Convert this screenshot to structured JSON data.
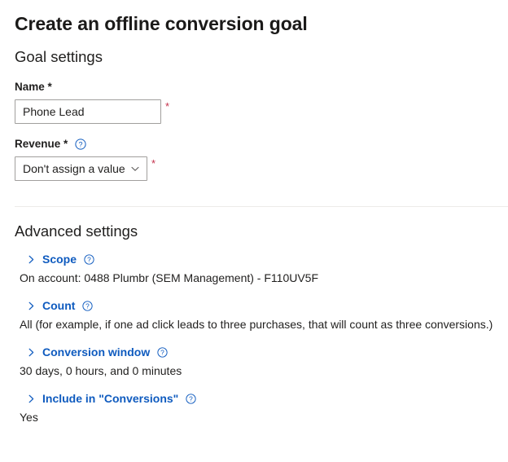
{
  "page": {
    "title": "Create an offline conversion goal"
  },
  "goal_settings": {
    "heading": "Goal settings",
    "name_field": {
      "label": "Name *",
      "value": "Phone Lead",
      "placeholder": "",
      "required_marker": "*"
    },
    "revenue_field": {
      "label": "Revenue *",
      "help_icon": "help-circle-icon",
      "selected_option": "Don't assign a value",
      "required_marker": "*",
      "chevron_icon": "chevron-down-icon"
    }
  },
  "advanced_settings": {
    "heading": "Advanced settings",
    "groups": [
      {
        "title": "Scope",
        "value": "On account: 0488 Plumbr (SEM Management) - F110UV5F",
        "expand_icon": "chevron-right-icon",
        "help_icon": "help-circle-icon"
      },
      {
        "title": "Count",
        "value": "All (for example, if one ad click leads to three purchases, that will count as three conversions.)",
        "expand_icon": "chevron-right-icon",
        "help_icon": "help-circle-icon"
      },
      {
        "title": "Conversion window",
        "value": "30 days, 0 hours, and 0 minutes",
        "expand_icon": "chevron-right-icon",
        "help_icon": "help-circle-icon"
      },
      {
        "title": "Include in \"Conversions\"",
        "value": "Yes",
        "expand_icon": "chevron-right-icon",
        "help_icon": "help-circle-icon"
      }
    ]
  },
  "colors": {
    "link_blue": "#0f5bbf",
    "required_red": "#c4314b",
    "text": "#201f1e",
    "border": "#a19f9d",
    "divider": "#edebe9"
  }
}
